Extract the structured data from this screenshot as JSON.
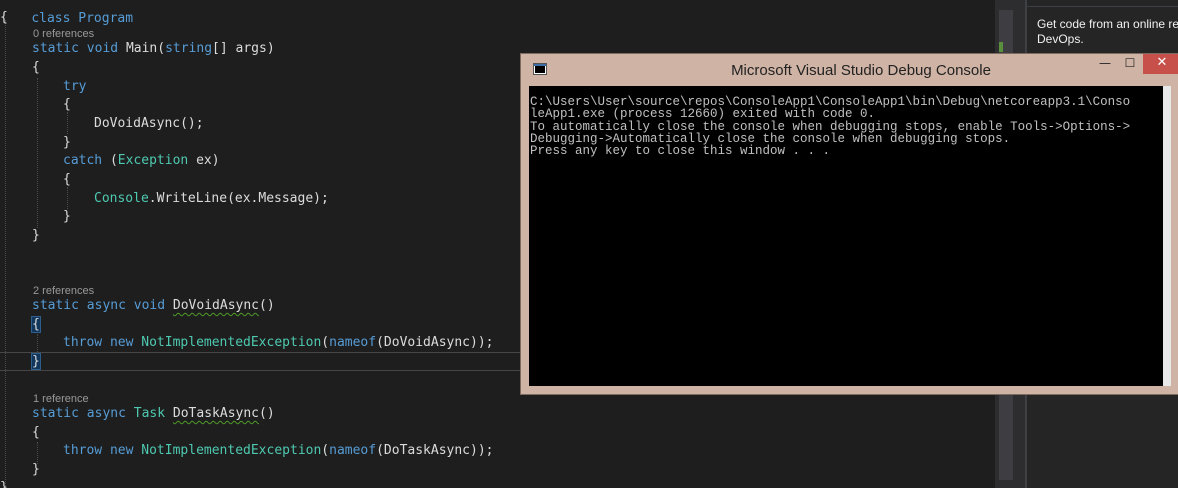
{
  "editor": {
    "top_partial": "class Program",
    "open_brace": "{",
    "main": {
      "codelens": "0 references",
      "kw1": "static",
      "kw2": "void",
      "name": "Main",
      "p_open": "(",
      "param_type": "string",
      "param_rest": "[] args)",
      "brace_open": "{",
      "try_kw": "try",
      "try_open": "{",
      "call": "DoVoidAsync();",
      "try_close": "}",
      "catch_kw": "catch",
      "catch_open_paren": " (",
      "catch_type": "Exception",
      "catch_var": " ex)",
      "catch_open": "{",
      "console_type": "Console",
      "console_rest": ".WriteLine(ex.Message);",
      "catch_close": "}",
      "brace_close": "}"
    },
    "do_void": {
      "codelens": "2 references",
      "kw1": "static",
      "kw2": "async",
      "kw3": "void",
      "name": "DoVoidAsync",
      "tail": "()",
      "brace_open": "{",
      "throw_kw": "throw",
      "new_kw": "new",
      "ex_type": "NotImplementedException",
      "paren_open": "(",
      "nameof_kw": "nameof",
      "arg": "(DoVoidAsync));",
      "brace_close": "}"
    },
    "do_task": {
      "codelens": "1 reference",
      "kw1": "static",
      "kw2": "async",
      "ret_type": "Task",
      "name": "DoTaskAsync",
      "tail": "()",
      "brace_open": "{",
      "throw_kw": "throw",
      "new_kw": "new",
      "ex_type": "NotImplementedException",
      "paren_open": "(",
      "nameof_kw": "nameof",
      "arg": "(DoTaskAsync));",
      "brace_close": "}"
    },
    "class_close": "}"
  },
  "right_panel": {
    "line1": "Get code from an online re",
    "line2": "DevOps."
  },
  "console": {
    "title": "Microsoft Visual Studio Debug Console",
    "app_icon": "console-app-icon",
    "minimize_glyph": "—",
    "maximize_glyph": "☐",
    "close_glyph": "✕",
    "output": "C:\\Users\\User\\source\\repos\\ConsoleApp1\\ConsoleApp1\\bin\\Debug\\netcoreapp3.1\\Conso\nleApp1.exe (process 12660) exited with code 0.\nTo automatically close the console when debugging stops, enable Tools->Options->\nDebugging->Automatically close the console when debugging stops.\nPress any key to close this window . . ."
  },
  "colors": {
    "editor_bg": "#1e1e1e",
    "keyword": "#569cd6",
    "type": "#4ec9b0",
    "text": "#dcdcdc",
    "console_frame": "#cfb3a4",
    "close_button": "#c7504b"
  }
}
